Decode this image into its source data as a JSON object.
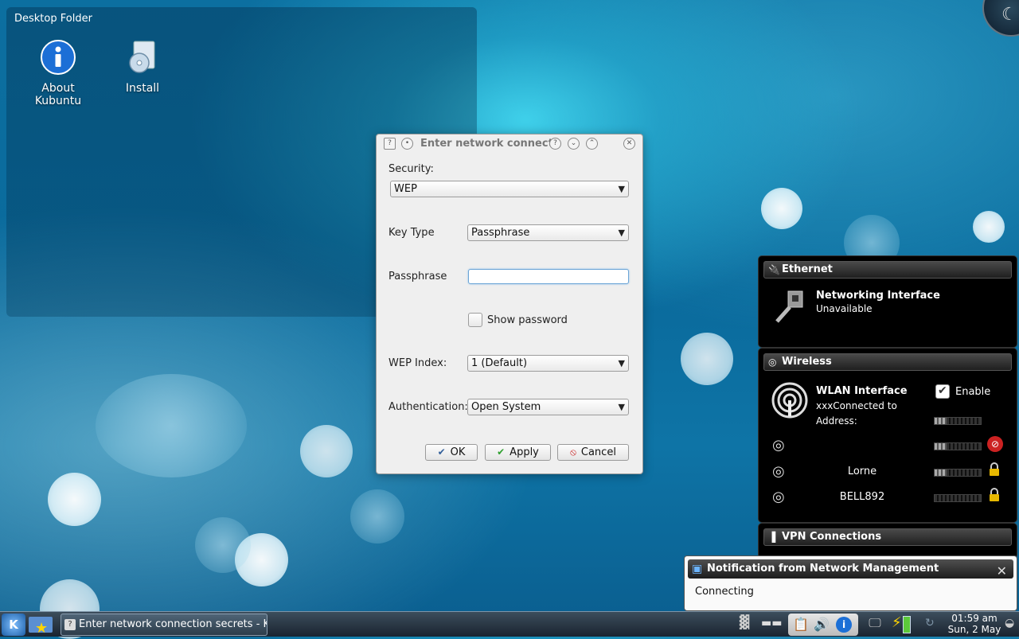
{
  "desktop": {
    "folder_title": "Desktop Folder",
    "icons": [
      {
        "label_line1": "About",
        "label_line2": "Kubuntu",
        "icon": "info-icon"
      },
      {
        "label_line1": "Install",
        "label_line2": "",
        "icon": "install-cd-icon"
      }
    ]
  },
  "dialog": {
    "title": "Enter network connect",
    "security_label": "Security:",
    "security_value": "WEP",
    "key_type_label": "Key Type",
    "key_type_value": "Passphrase",
    "passphrase_label": "Passphrase",
    "passphrase_value": "",
    "show_password_label": "Show password",
    "wep_index_label": "WEP Index:",
    "wep_index_value": "1 (Default)",
    "auth_label": "Authentication:",
    "auth_value": "Open System",
    "ok_label": "OK",
    "apply_label": "Apply",
    "cancel_label": "Cancel"
  },
  "network_panel": {
    "ethernet": {
      "title": "Ethernet",
      "interface_name": "Networking Interface",
      "status": "Unavailable"
    },
    "wireless": {
      "title": "Wireless",
      "interface_name": "WLAN Interface",
      "status": "xxxConnected to",
      "address_label": "Address:",
      "enable_label": "Enable",
      "enabled": true,
      "networks": [
        {
          "name": "",
          "signal": 0.25,
          "security": "no-lock-icon"
        },
        {
          "name": "Lorne",
          "signal": 0.25,
          "security": "lock-icon"
        },
        {
          "name": "BELL892",
          "signal": 0.0,
          "security": "lock-icon"
        }
      ]
    },
    "vpn": {
      "title": "VPN Connections"
    }
  },
  "notification": {
    "title": "Notification from Network Management",
    "message": "Connecting"
  },
  "taskbar": {
    "task_label": "Enter network connection secrets - KD",
    "clock_time": "01:59 am",
    "clock_date": "Sun, 2 May"
  },
  "colors": {
    "desktop_blue": "#0c6fa0",
    "panel_bg": "#000000",
    "focus_blue": "#6ca5d6"
  }
}
